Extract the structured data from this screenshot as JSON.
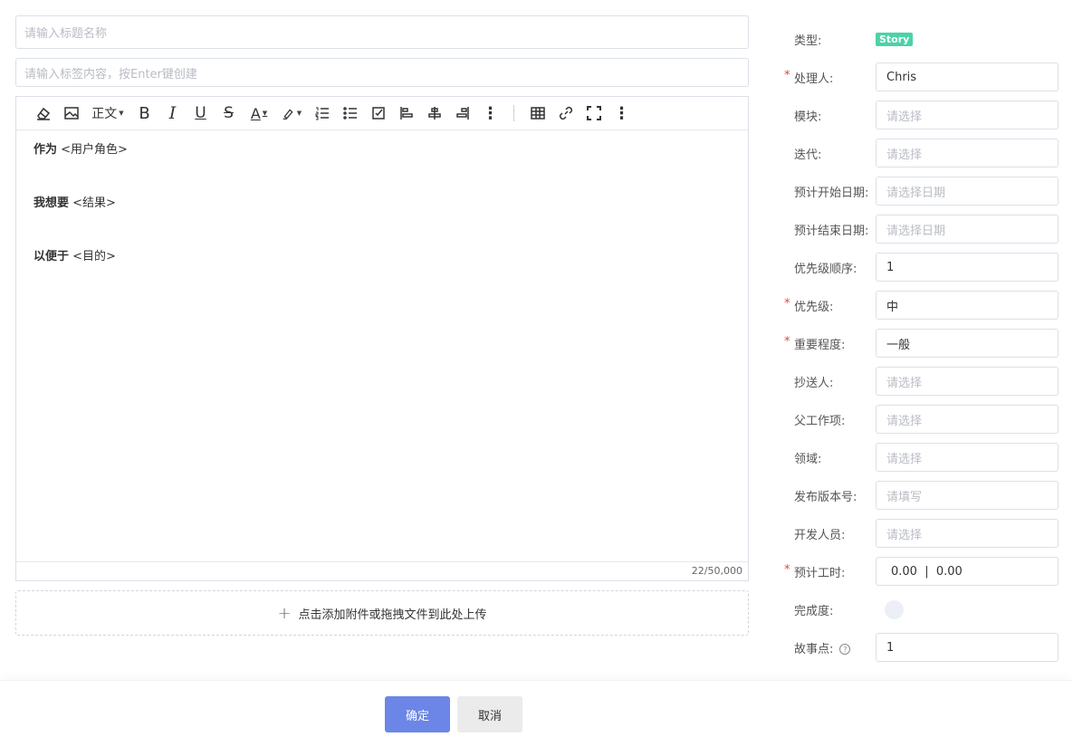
{
  "form": {
    "title_placeholder": "请输入标题名称",
    "tags_placeholder": "请输入标签内容，按Enter键创建"
  },
  "toolbar": {
    "heading_label": "正文",
    "items": [
      "eraser-icon",
      "image-icon",
      "heading-select",
      "bold-icon",
      "italic-icon",
      "underline-icon",
      "strikethrough-icon",
      "font-color-icon",
      "highlight-icon",
      "ordered-list-icon",
      "bullet-list-icon",
      "todo-icon",
      "align-left-icon",
      "align-center-icon",
      "align-right-icon",
      "more-icon",
      "table-icon",
      "link-icon",
      "fullscreen-icon",
      "more-icon-2"
    ]
  },
  "editor": {
    "lines": [
      {
        "bold": "作为",
        "text": " <用户角色>"
      },
      {
        "bold": "我想要",
        "text": " <结果>"
      },
      {
        "bold": "以便于",
        "text": " <目的>"
      }
    ],
    "counter": "22/50,000"
  },
  "upload": {
    "label": "点击添加附件或拖拽文件到此处上传"
  },
  "side": {
    "type_label": "类型:",
    "type_value": "Story",
    "assignee_label": "处理人:",
    "assignee_value": "Chris",
    "module_label": "模块:",
    "module_placeholder": "请选择",
    "iteration_label": "迭代:",
    "iteration_placeholder": "请选择",
    "start_label": "预计开始日期:",
    "start_placeholder": "请选择日期",
    "end_label": "预计结束日期:",
    "end_placeholder": "请选择日期",
    "priority_order_label": "优先级顺序:",
    "priority_order_value": "1",
    "priority_label": "优先级:",
    "priority_value": "中",
    "importance_label": "重要程度:",
    "importance_value": "一般",
    "cc_label": "抄送人:",
    "cc_placeholder": "请选择",
    "parent_label": "父工作项:",
    "parent_placeholder": "请选择",
    "domain_label": "领域:",
    "domain_placeholder": "请选择",
    "release_label": "发布版本号:",
    "release_placeholder": "请填写",
    "dev_label": "开发人员:",
    "dev_placeholder": "请选择",
    "hours_label": "预计工时:",
    "hours_value": "0.00  |  0.00",
    "progress_label": "完成度:",
    "progress_value": 0,
    "points_label": "故事点:",
    "points_value": "1",
    "star": "*"
  },
  "buttons": {
    "ok": "确定",
    "cancel": "取消"
  },
  "colors": {
    "primary": "#6b86e6",
    "story_tag": "#4cd2a8",
    "required": "#e54545"
  }
}
